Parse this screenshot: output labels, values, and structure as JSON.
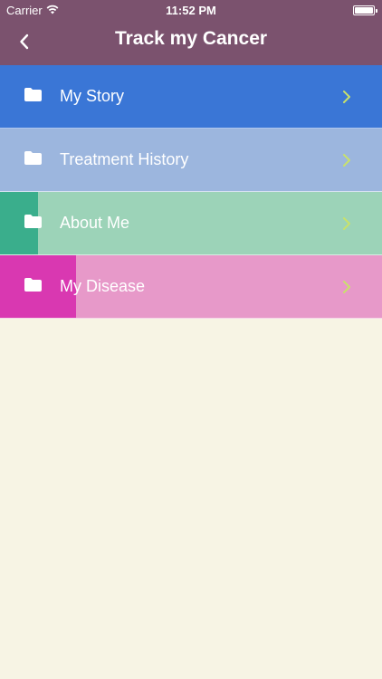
{
  "status_bar": {
    "carrier": "Carrier",
    "time": "11:52 PM"
  },
  "header": {
    "title": "Track my Cancer",
    "back_icon": "chevron-left-icon"
  },
  "menu": {
    "items": [
      {
        "label": "My Story",
        "background": "#3a76d6",
        "accent": "#3a76d6",
        "chevron_color": "#c9e26a",
        "icon": "folder-icon"
      },
      {
        "label": "Treatment History",
        "background": "#9cb6de",
        "accent": "#9cb6de",
        "chevron_color": "#c9e26a",
        "icon": "folder-icon"
      },
      {
        "label": "About Me",
        "background": "#9cd3b8",
        "accent": "#3aae8c",
        "chevron_color": "#c9e26a",
        "icon": "folder-icon"
      },
      {
        "label": "My Disease",
        "background": "#e799c9",
        "accent": "#d938b1",
        "chevron_color": "#c9e26a",
        "icon": "folder-icon"
      }
    ]
  },
  "colors": {
    "header": "#7b526e",
    "page_background": "#f7f4e4"
  }
}
